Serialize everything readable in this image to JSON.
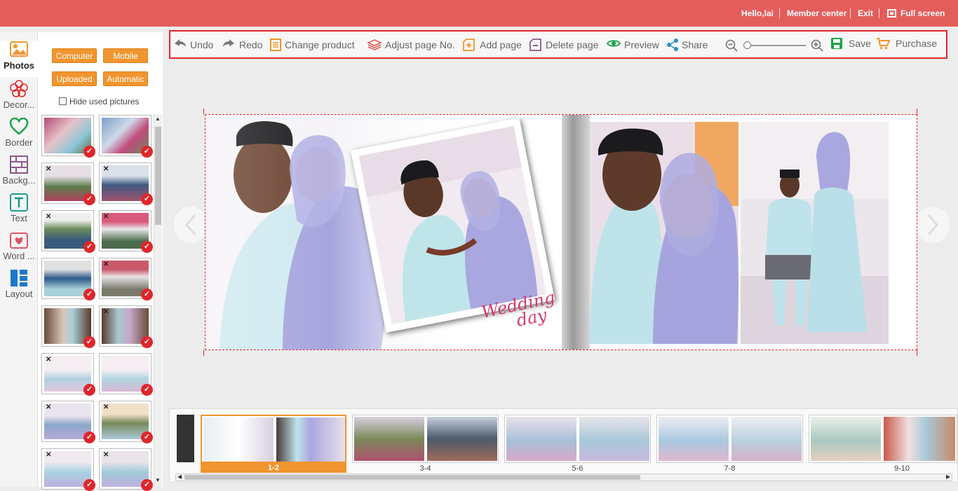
{
  "top_bar": {
    "greeting": "Hello,lai",
    "member_center": "Member center",
    "exit": "Exit",
    "full_screen": "Full screen"
  },
  "sidebar": {
    "items": [
      {
        "label": "Photos",
        "icon": "photo-icon"
      },
      {
        "label": "Decor...",
        "icon": "flower-icon"
      },
      {
        "label": "Border",
        "icon": "heart-icon"
      },
      {
        "label": "Backg...",
        "icon": "background-icon"
      },
      {
        "label": "Text",
        "icon": "text-icon"
      },
      {
        "label": "Word ...",
        "icon": "word-art-icon"
      },
      {
        "label": "Layout",
        "icon": "layout-icon"
      }
    ],
    "active_item": "Photos"
  },
  "photo_panel": {
    "source_buttons": [
      "Computer",
      "Mobile",
      "Uploaded",
      "Automatic"
    ],
    "hide_used_label": "Hide used pictures",
    "hide_used_checked": false
  },
  "toolbar": {
    "undo": "Undo",
    "redo": "Redo",
    "change_product": "Change  product",
    "adjust_page_no": "Adjust page No.",
    "add_page": "Add page",
    "delete_page": "Delete page",
    "preview": "Preview",
    "share": "Share",
    "save": "Save",
    "purchase": "Purchase",
    "zoom_level": 0
  },
  "canvas": {
    "wedding_text_line1": "Wedding",
    "wedding_text_line2": "day"
  },
  "filmstrip": {
    "spreads": [
      {
        "label": "1-2",
        "active": true
      },
      {
        "label": "3-4",
        "active": false
      },
      {
        "label": "5-6",
        "active": false
      },
      {
        "label": "7-8",
        "active": false
      },
      {
        "label": "9-10",
        "active": false
      }
    ]
  },
  "colors": {
    "top_bar": "#e35d5b",
    "accent_orange": "#f0952f",
    "selection_red": "#e0262b",
    "mint_outfit": "#bfe5e8",
    "lavender_hijab": "#a9a7e0"
  }
}
